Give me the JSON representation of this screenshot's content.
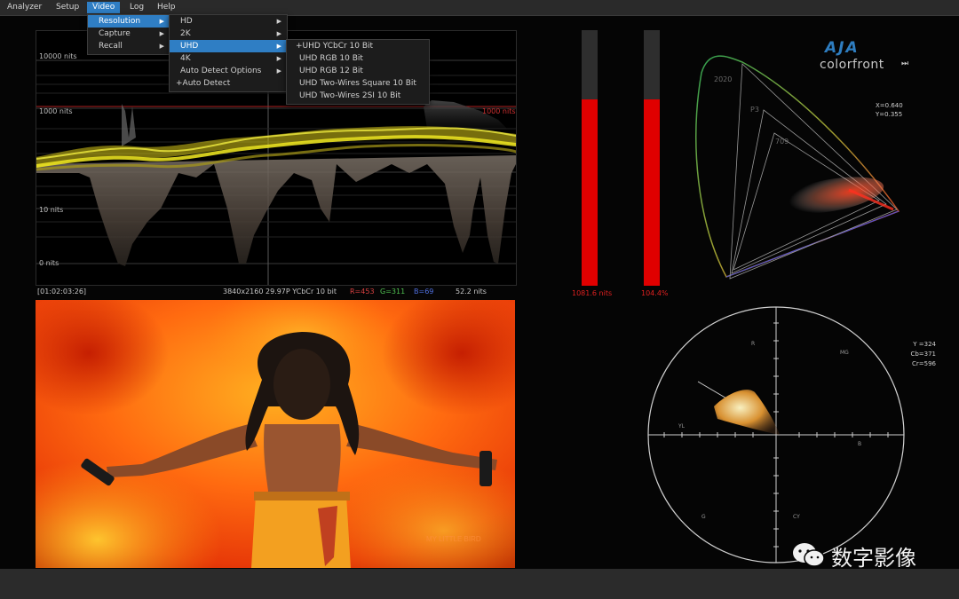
{
  "menubar": {
    "items": [
      "Analyzer",
      "Setup",
      "Video",
      "Log",
      "Help"
    ]
  },
  "video_menu": {
    "items": [
      "Resolution",
      "Capture",
      "Recall"
    ]
  },
  "resolution_menu": {
    "items": [
      "HD",
      "2K",
      "UHD",
      "4K",
      "Auto Detect Options",
      "+Auto Detect"
    ]
  },
  "uhd_menu": {
    "items": [
      "+UHD YCbCr 10 Bit",
      "UHD RGB 10 Bit",
      "UHD RGB 12 Bit",
      "UHD Two-Wires Square 10 Bit",
      "UHD Two-Wires 2SI 10 Bit"
    ]
  },
  "waveform": {
    "labels": [
      "10000 nits",
      "1000 nits",
      "10 nits",
      "0 nits"
    ],
    "marker_label": "1000 nits",
    "marker_color": "#c02020",
    "trace_color": "#e8e020"
  },
  "status": {
    "timecode": "[01:02:03:26]",
    "format": "3840x2160 29.97P YCbCr 10 bit",
    "r": "R=453",
    "g": "G=311",
    "b": "B=69",
    "nits": "52.2 nits"
  },
  "meters": [
    {
      "label": "1081.6 nits",
      "level": 0.73
    },
    {
      "label": "104.4%",
      "level": 0.73
    }
  ],
  "branding": {
    "aja": "AJA",
    "colorfront": "colorfront"
  },
  "cie": {
    "gamut_labels": [
      "2020",
      "P3",
      "709"
    ],
    "x": "X=0.640",
    "y": "Y=0.355"
  },
  "vectorscope": {
    "y": "Y =324",
    "cb": "Cb=371",
    "cr": "Cr=596",
    "targets": [
      "R",
      "MG",
      "B",
      "CY",
      "G",
      "YL"
    ]
  },
  "watermark": {
    "text": "数字影像"
  },
  "image_overlay": {
    "text": "MY LITTLE BIRD"
  }
}
